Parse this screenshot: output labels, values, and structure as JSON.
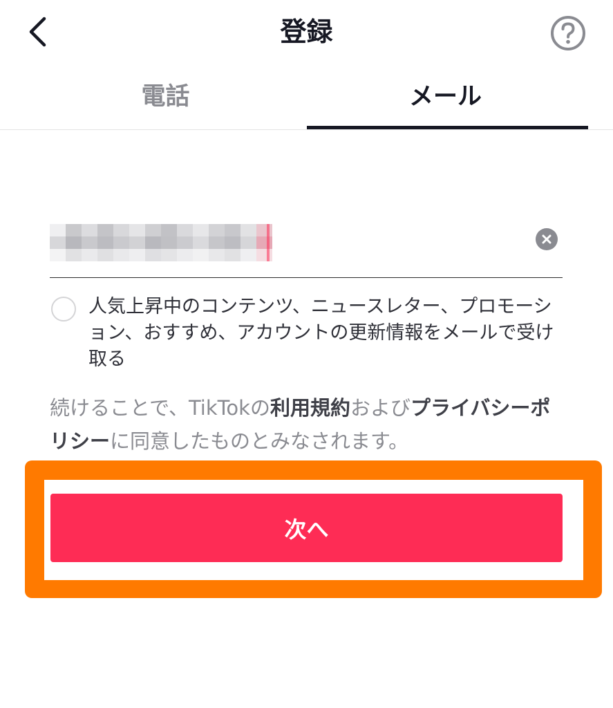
{
  "header": {
    "title": "登録",
    "back_icon": "chevron-left-icon",
    "help_icon": "question-circle-icon"
  },
  "tabs": [
    {
      "label": "電話",
      "active": false
    },
    {
      "label": "メール",
      "active": true
    }
  ],
  "email": {
    "value": "",
    "value_redacted": true
  },
  "consent": {
    "checked": false,
    "text": "人気上昇中のコンテンツ、ニュースレター、プロモーション、おすすめ、アカウントの更新情報をメールで受け取る"
  },
  "terms": {
    "prefix": "続けることで、TikTokの",
    "terms_link": "利用規約",
    "middle": "および",
    "privacy_link": "プライバシーポリシー",
    "suffix": "に同意したものとみなされます。"
  },
  "next_button": {
    "label": "次へ"
  },
  "colors": {
    "primary": "#fe2c55",
    "highlight": "#ff7a00",
    "text": "#161823",
    "muted": "#8a8b91"
  }
}
